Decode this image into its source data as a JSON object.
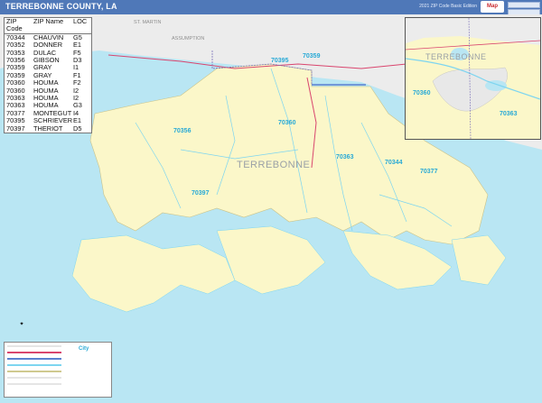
{
  "header": {
    "title": "TERREBONNE COUNTY, LA",
    "edition": "2021 ZIP Code Basic Edition",
    "logo": "Map"
  },
  "zip_table": {
    "columns": [
      "ZIP Code",
      "ZIP Name",
      "LOC"
    ],
    "rows": [
      [
        "70344",
        "CHAUVIN",
        "G5"
      ],
      [
        "70352",
        "DONNER",
        "E1"
      ],
      [
        "70353",
        "DULAC",
        "F5"
      ],
      [
        "70356",
        "GIBSON",
        "D3"
      ],
      [
        "70359",
        "GRAY",
        "I1"
      ],
      [
        "70359",
        "GRAY",
        "F1"
      ],
      [
        "70360",
        "HOUMA",
        "F2"
      ],
      [
        "70360",
        "HOUMA",
        "I2"
      ],
      [
        "70363",
        "HOUMA",
        "I2"
      ],
      [
        "70363",
        "HOUMA",
        "G3"
      ],
      [
        "70377",
        "MONTEGUT",
        "I4"
      ],
      [
        "70395",
        "SCHRIEVER",
        "E1"
      ],
      [
        "70397",
        "THERIOT",
        "D5"
      ]
    ]
  },
  "map_labels": {
    "zip_70395": "70395",
    "zip_70359": "70359",
    "zip_70360": "70360",
    "zip_70356": "70356",
    "zip_70363": "70363",
    "zip_70344": "70344",
    "zip_70377": "70377",
    "zip_70397": "70397",
    "county": "TERREBONNE",
    "st_martin": "ST. MARTIN",
    "assumption": "ASSUMPTION"
  },
  "inset": {
    "county": "TERREBONNE",
    "zip_70360": "70360",
    "zip_70363": "70363"
  },
  "legend": {
    "city_label": "City"
  },
  "colors": {
    "header": "#4f78b8",
    "water": "#b9e6f3",
    "land": "#fbf7c9",
    "outside_land": "#ececec",
    "zip_label": "#27a9d6",
    "highway": "#d9456e"
  }
}
